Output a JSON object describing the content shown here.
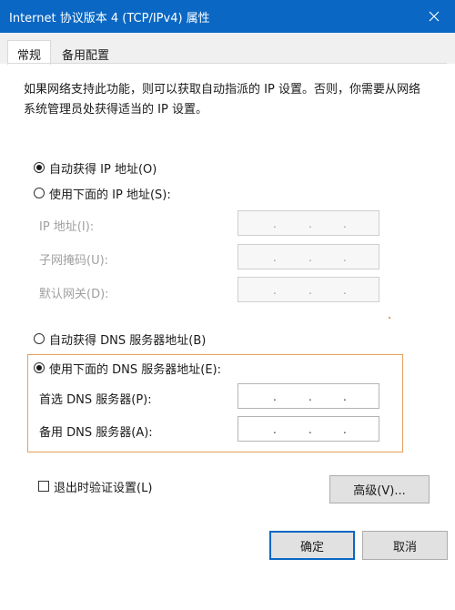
{
  "window": {
    "title": "Internet 协议版本 4 (TCP/IPv4) 属性",
    "close_symbol": "✕"
  },
  "tabs": [
    {
      "label": "常规",
      "active": true
    },
    {
      "label": "备用配置",
      "active": false
    }
  ],
  "description": "如果网络支持此功能，则可以获取自动指派的 IP 设置。否则，你需要从网络系统管理员处获得适当的 IP 设置。",
  "ip_section": {
    "auto_option": "自动获得 IP 地址(O)",
    "manual_option": "使用下面的 IP 地址(S):",
    "selected": "auto",
    "fields": [
      {
        "label": "IP 地址(I):",
        "value": ". . ."
      },
      {
        "label": "子网掩码(U):",
        "value": ". . ."
      },
      {
        "label": "默认网关(D):",
        "value": ". . ."
      }
    ]
  },
  "dns_section": {
    "auto_option": "自动获得 DNS 服务器地址(B)",
    "manual_option": "使用下面的 DNS 服务器地址(E):",
    "selected": "manual",
    "fields": [
      {
        "label": "首选 DNS 服务器(P):"
      },
      {
        "label": "备用 DNS 服务器(A):"
      }
    ]
  },
  "validate_checkbox": {
    "label": "退出时验证设置(L)",
    "checked": false
  },
  "buttons": {
    "advanced": "高级(V)...",
    "ok": "确定",
    "cancel": "取消"
  },
  "colors": {
    "titlebar": "#0a67c3",
    "focus_border": "#e6a15a",
    "disabled_text": "#a0a0a0"
  }
}
